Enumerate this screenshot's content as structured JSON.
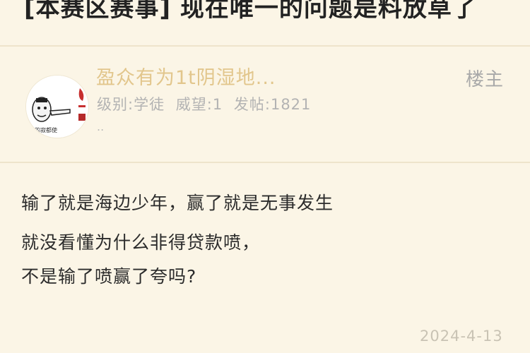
{
  "thread": {
    "title": "[本赛区赛事] 现在唯一的问题是料放草了"
  },
  "author": {
    "username": "盈众有为1t阴湿地...",
    "level": "级别:学徒",
    "prestige": "威望:1",
    "posts": "发帖:1821",
    "extra": "..",
    "badge": "楼主",
    "avatar_caption": "的寂都使"
  },
  "post": {
    "lines": [
      "输了就是海边少年，赢了就是无事发生",
      "就没看懂为什么非得贷款喷，",
      "不是输了喷赢了夸吗?"
    ],
    "date": "2024-4-13"
  },
  "colors": {
    "background": "#fbf5e6",
    "username": "#e2c68c",
    "divider": "#eee4cb"
  }
}
